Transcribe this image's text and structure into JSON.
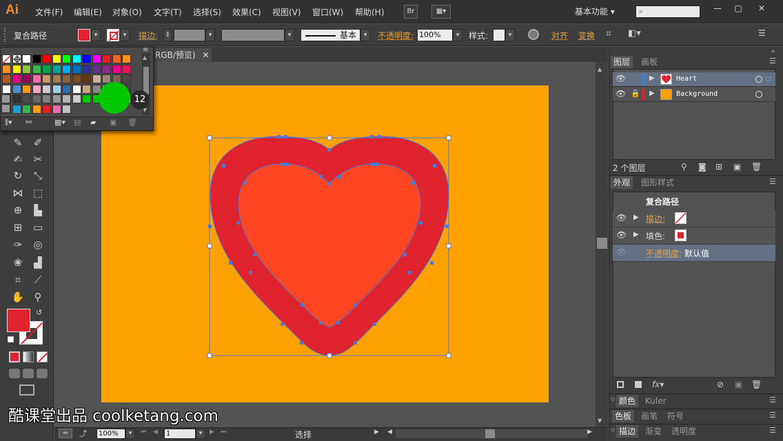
{
  "app": {
    "logo": "Ai",
    "menu": [
      "文件(F)",
      "编辑(E)",
      "对象(O)",
      "文字(T)",
      "选择(S)",
      "效果(C)",
      "视图(V)",
      "窗口(W)",
      "帮助(H)"
    ],
    "bridge_btn": "Br",
    "workspace": "基本功能",
    "window_controls": [
      "—",
      "▢",
      "✕"
    ]
  },
  "control_bar": {
    "selection_type": "复合路径",
    "stroke_label": "描边:",
    "stroke_style": "基本",
    "opacity_label": "不透明度:",
    "opacity_value": "100%",
    "style_label": "样式:",
    "align_label": "对齐",
    "transform_label": "变换"
  },
  "document_tab": {
    "label": "RGB/预览)",
    "close": "✕"
  },
  "swatch_panel": {
    "badge": "12",
    "colors": {
      "fill": "#e0232e",
      "artboard": "#ffa100",
      "inner_heart": "#ff4522",
      "highlight": "#00c800"
    }
  },
  "layers_panel": {
    "tabs": [
      "图层",
      "画板"
    ],
    "layers": [
      {
        "name": "Heart",
        "color": "#3b7ddd"
      },
      {
        "name": "Background",
        "color": "#e0232e"
      }
    ],
    "count": "2 个图层"
  },
  "appearance_panel": {
    "tabs": [
      "外观",
      "图形样式"
    ],
    "title": "复合路径",
    "rows": [
      {
        "label": "描边:"
      },
      {
        "label": "填色:"
      },
      {
        "label": "不透明度:",
        "value": "默认值"
      }
    ]
  },
  "collapsed_panels": [
    {
      "tabs": [
        "颜色",
        "Kuler"
      ]
    },
    {
      "tabs": [
        "色板",
        "画笔",
        "符号"
      ]
    },
    {
      "tabs": [
        "描边",
        "渐变",
        "透明度"
      ]
    }
  ],
  "status_bar": {
    "zoom": "100%",
    "page": "1",
    "tool": "选择"
  },
  "watermark": "酷课堂出品 coolketang.com"
}
